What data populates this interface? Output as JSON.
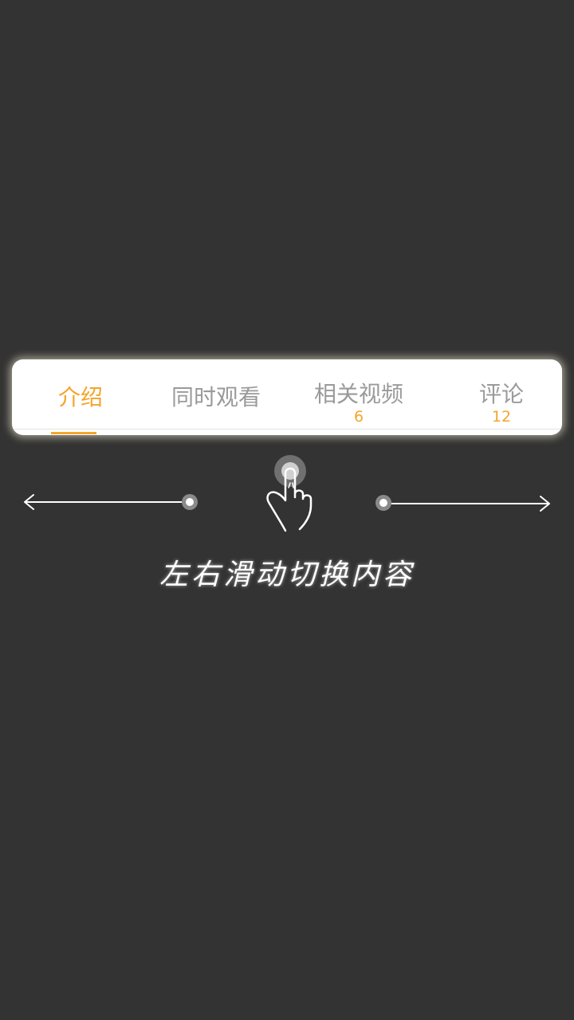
{
  "tabs": [
    {
      "label": "介绍",
      "count": "",
      "active": true
    },
    {
      "label": "同时观看",
      "count": "",
      "active": false
    },
    {
      "label": "相关视频",
      "count": "6",
      "active": false
    },
    {
      "label": "评论",
      "count": "12",
      "active": false
    }
  ],
  "hint": {
    "text": "左右滑动切换内容"
  },
  "colors": {
    "accent": "#f4a52a",
    "inactive_text": "#9a9a9a",
    "overlay_bg": "#333333"
  },
  "icons": {
    "gesture": "swipe-hand-icon",
    "left_arrow": "arrow-left-icon",
    "right_arrow": "arrow-right-icon"
  }
}
